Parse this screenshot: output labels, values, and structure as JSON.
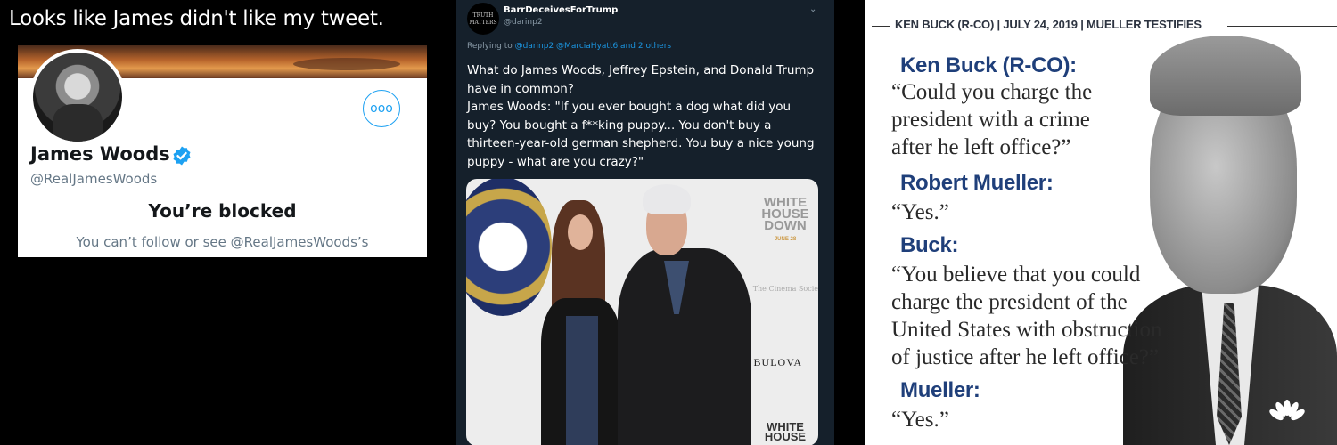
{
  "left_panel": {
    "caption": "Looks like James didn't like my tweet.",
    "profile": {
      "name": "James Woods",
      "handle": "@RealJamesWoods",
      "more_label": "ooo",
      "blocked_title": "You’re blocked",
      "blocked_text": "You can’t follow or see @RealJamesWoods’s"
    }
  },
  "tweet": {
    "avatar_text": "TRUTH MATTERS",
    "author_name": "BarrDeceivesForTrump",
    "author_handle": "@darinp2",
    "replying_prefix": "Replying to",
    "replying_mentions": "@darinp2 @MarciaHyatt6 and 2 others",
    "text": "What do James Woods, Jeffrey Epstein, and Donald Trump have in common?\nJames Woods: \"If you ever bought a dog what did you buy? You bought a f**king puppy... You don't buy a thirteen-year-old german shepherd. You buy a nice young puppy - what are you crazy?\"",
    "image": {
      "wh_logo_top": "WHITE HOUSE DOWN",
      "wh_date": "JUNE 28",
      "cinema_text": "The Cinema Socie",
      "bulova": "BULOVA",
      "wh_logo_bottom": "WHITE HOUSE"
    }
  },
  "right_panel": {
    "header": "KEN BUCK (R-CO) | JULY 24, 2019 | MUELLER TESTIFIES",
    "exchange": [
      {
        "speaker": "Ken Buck (R-CO):",
        "quote": "“Could you charge the\npresident with a crime\nafter he left office?”"
      },
      {
        "speaker": "Robert Mueller:",
        "quote": "“Yes.”"
      },
      {
        "speaker": "Buck:",
        "quote": "“You believe that you could\ncharge the president of the\nUnited States with obstruction\nof justice after he left office?”"
      },
      {
        "speaker": "Mueller:",
        "quote": "“Yes.”"
      }
    ]
  },
  "colors": {
    "twitter_blue": "#1da1f2",
    "tweet_bg": "#15202b",
    "speaker_blue": "#1f3f7a"
  },
  "icons": [
    "verified-badge-icon",
    "more-options-icon",
    "chevron-down-icon",
    "nbc-peacock-icon"
  ]
}
